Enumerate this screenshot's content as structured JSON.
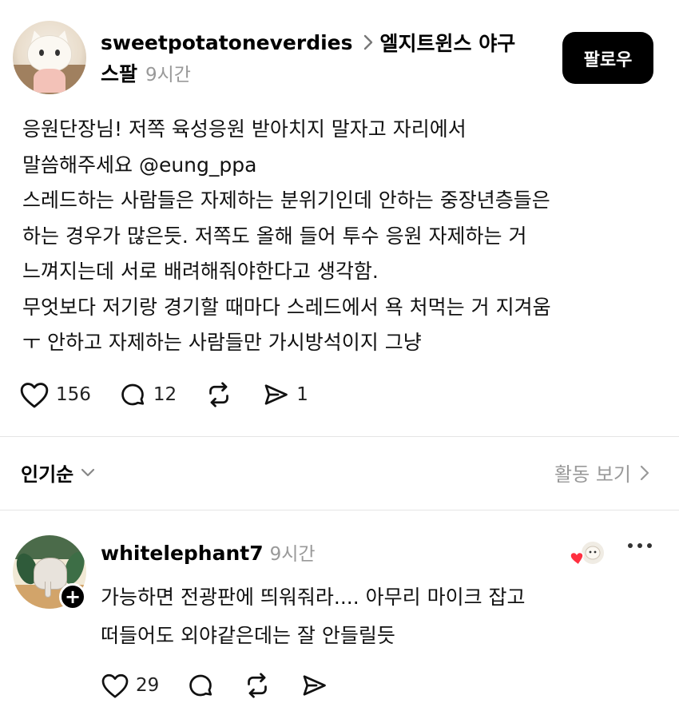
{
  "post": {
    "username": "sweetpotatoneverdies",
    "topic_part1": "엘지트윈스 야구",
    "topic_part2": "스팔",
    "time": "9시간",
    "follow_label": "팔로우",
    "body_lines": [
      "응원단장님! 저쪽 육성응원 받아치지 말자고 자리에서",
      "말씀해주세요 @eung_ppa",
      "스레드하는 사람들은 자제하는 분위기인데 안하는 중장년층들은",
      "하는 경우가 많은듯. 저쪽도 올해 들어 투수 응원 자제하는 거",
      "느껴지는데 서로 배려해줘야한다고 생각함.",
      "무엇보다 저기랑 경기할 때마다 스레드에서 욕 처먹는 거 지겨움",
      "ㅜ 안하고 자제하는 사람들만 가시방석이지 그냥"
    ],
    "likes": "156",
    "comments": "12",
    "shares": "1"
  },
  "sort": {
    "label": "인기순",
    "activity_label": "활동 보기"
  },
  "reply": {
    "username": "whitelephant7",
    "time": "9시간",
    "body_lines": [
      "가능하면 전광판에 띄워줘라.... 아무리 마이크 잡고",
      "떠들어도 외야같은데는 잘 안들릴듯"
    ],
    "likes": "29",
    "add_symbol": "+"
  },
  "colors": {
    "like_badge": "#ff3040",
    "muted_text": "#999999"
  }
}
